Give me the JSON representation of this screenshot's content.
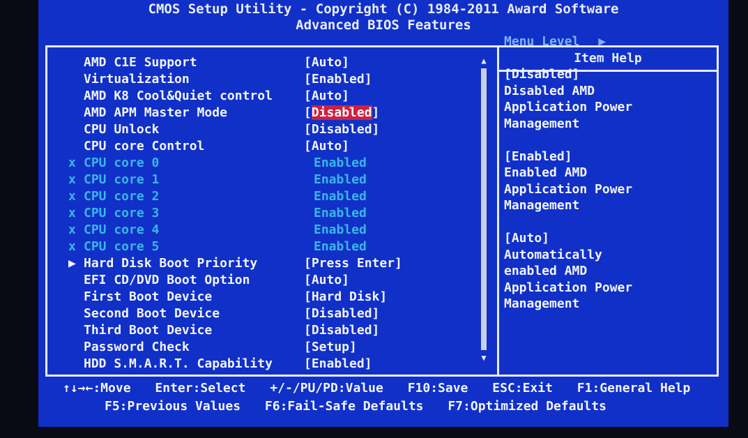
{
  "header": {
    "line1": "CMOS Setup Utility - Copyright (C) 1984-2011 Award Software",
    "line2": "Advanced BIOS Features"
  },
  "settings": [
    {
      "label": "AMD C1E Support",
      "value": "[Auto]"
    },
    {
      "label": "Virtualization",
      "value": "[Enabled]"
    },
    {
      "label": "AMD K8 Cool&Quiet control",
      "value": "[Auto]"
    },
    {
      "label": "AMD APM Master Mode",
      "value_open": "[",
      "value_selected": "Disabled",
      "value_close": "]"
    },
    {
      "label": "CPU Unlock",
      "value": "[Disabled]"
    },
    {
      "label": "CPU core Control",
      "value": "[Auto]"
    },
    {
      "marker": "x",
      "label": "CPU core 0",
      "value": "Enabled"
    },
    {
      "marker": "x",
      "label": "CPU core 1",
      "value": "Enabled"
    },
    {
      "marker": "x",
      "label": "CPU core 2",
      "value": "Enabled"
    },
    {
      "marker": "x",
      "label": "CPU core 3",
      "value": "Enabled"
    },
    {
      "marker": "x",
      "label": "CPU core 4",
      "value": "Enabled"
    },
    {
      "marker": "x",
      "label": "CPU core 5",
      "value": "Enabled"
    },
    {
      "marker": "▶",
      "label": "Hard Disk Boot Priority",
      "value": "[Press Enter]"
    },
    {
      "label": "EFI CD/DVD Boot Option",
      "value": "[Auto]"
    },
    {
      "label": "First Boot Device",
      "value": "[Hard Disk]"
    },
    {
      "label": "Second Boot Device",
      "value": "[Disabled]"
    },
    {
      "label": "Third Boot Device",
      "value": "[Disabled]"
    },
    {
      "label": "Password Check",
      "value": "[Setup]"
    },
    {
      "label": "HDD S.M.A.R.T. Capability",
      "value": "[Enabled]"
    }
  ],
  "scrollbar": {
    "up_icon": "▲",
    "down_icon": "▼"
  },
  "help": {
    "title": "Item Help",
    "menu_level": "Menu Level",
    "menu_level_icon": "▶",
    "blocks": [
      {
        "head": "[Disabled]",
        "lines": [
          "Disabled AMD",
          "Application Power",
          "Management"
        ]
      },
      {
        "head": "[Enabled]",
        "lines": [
          "Enabled AMD",
          "Application Power",
          "Management"
        ]
      },
      {
        "head": "[Auto]",
        "lines": [
          "Automatically",
          "enabled AMD",
          "Application Power",
          "Management"
        ]
      }
    ]
  },
  "footer": {
    "move": "↑↓→←:Move",
    "select": "Enter:Select",
    "value": "+/-/PU/PD:Value",
    "save": "F10:Save",
    "exit": "ESC:Exit",
    "help": "F1:General Help",
    "previous": "F5:Previous Values",
    "failsafe": "F6:Fail-Safe Defaults",
    "optimized": "F7:Optimized Defaults"
  },
  "colors": {
    "background": "#1030c8",
    "text": "#f2f4ff",
    "disabled_text": "#38b8e8",
    "highlight": "#d02040"
  }
}
